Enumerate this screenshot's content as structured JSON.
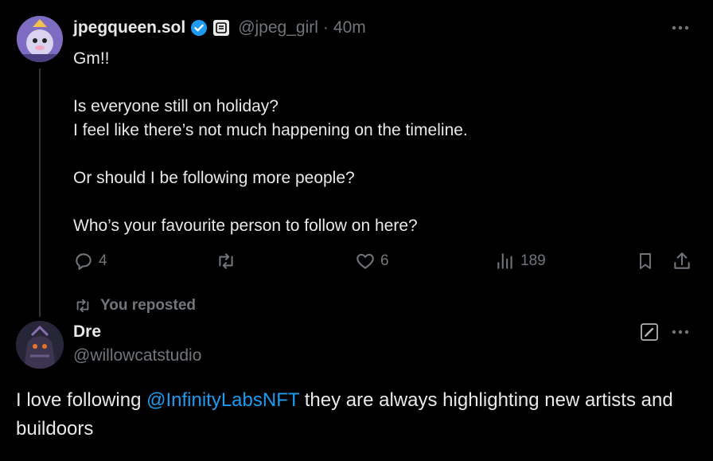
{
  "tweet": {
    "author_name": "jpegqueen.sol",
    "handle": "@jpeg_girl",
    "separator": "·",
    "time": "40m",
    "text": "Gm!!\n\nIs everyone still on holiday?\nI feel like there’s not much happening on the timeline.\n\nOr should I be following more people?\n\nWho’s your favourite person to follow on here?",
    "actions": {
      "replies": "4",
      "likes": "6",
      "views": "189"
    },
    "colors": {
      "verified": "#1d9bf0",
      "muted": "#71767b"
    }
  },
  "repost_banner": {
    "text": "You reposted"
  },
  "reply": {
    "author_name": "Dre",
    "handle": "@willowcatstudio",
    "text_before": "I love following ",
    "mention": "@InfinityLabsNFT",
    "text_after": " they are always highlighting new artists and buildoors"
  },
  "icons": [
    "verified-badge-icon",
    "affiliate-badge-icon",
    "more-icon",
    "reply-icon",
    "repost-icon",
    "like-icon",
    "views-icon",
    "bookmark-icon",
    "share-icon",
    "edit-icon"
  ]
}
